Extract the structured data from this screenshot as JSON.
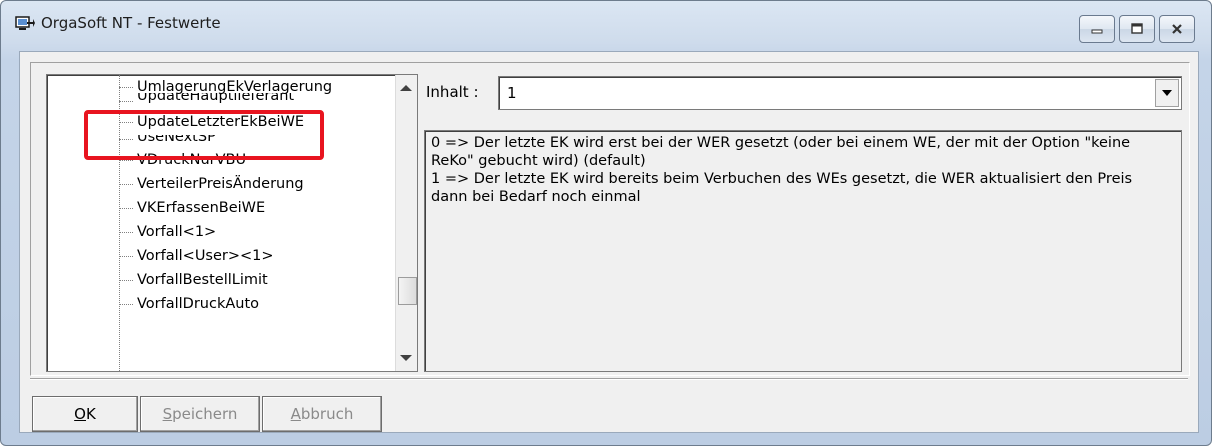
{
  "window": {
    "title": "OrgaSoft NT - Festwerte"
  },
  "tree": {
    "items": [
      "UmlagerungEkVerlagerung",
      "UpdateHauptlieferant",
      "UpdateLetzterEkBeiWE",
      "UseNextSP",
      "VDruckNurVBU",
      "VerteilerPreisÄnderung",
      "VKErfassenBeiWE",
      "Vorfall<1>",
      "Vorfall<User><1>",
      "VorfallBestellLimit",
      "VorfallDruckAuto"
    ],
    "highlighted_item": "UpdateLetzterEkBeiWE"
  },
  "inhalt": {
    "label": "Inhalt :",
    "value": "1"
  },
  "description": {
    "lines": [
      "0 => Der letzte EK wird erst bei der WER gesetzt (oder bei einem WE, der mit der Option \"keine",
      "ReKo\" gebucht wird) (default)",
      "1 => Der letzte EK wird bereits beim Verbuchen des WEs gesetzt, die WER aktualisiert den Preis",
      "dann bei Bedarf noch einmal"
    ]
  },
  "buttons": {
    "ok": {
      "mnemonic": "O",
      "rest": "K"
    },
    "speichern": {
      "mnemonic": "S",
      "rest": "peichern"
    },
    "abbruch": {
      "mnemonic": "A",
      "rest": "bbruch"
    }
  },
  "colors": {
    "highlight": "#e8141f",
    "window_frame": "#c4d4e8"
  }
}
